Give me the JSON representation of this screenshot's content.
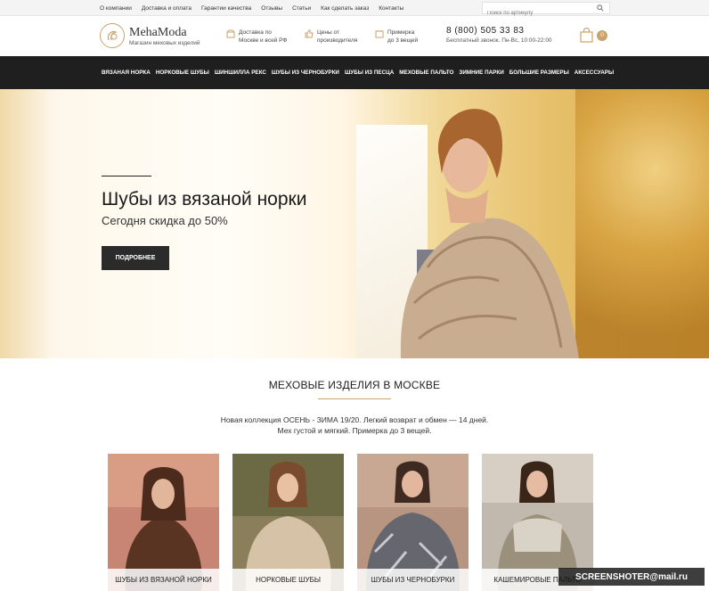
{
  "topbar": {
    "links": [
      "О компании",
      "Доставка и оплата",
      "Гарантии качества",
      "Отзывы",
      "Статьи",
      "Как сделать заказ",
      "Контакты"
    ],
    "search_placeholder": "Поиск по артикулу"
  },
  "header": {
    "logo_name": "MehaModa",
    "logo_sub": "Магазин меховых изделий",
    "features": [
      {
        "line1": "Доставка по",
        "line2": "Москве и всей РФ"
      },
      {
        "line1": "Цены от",
        "line2": "производителя"
      },
      {
        "line1": "Примерка",
        "line2": "до 3 вещей"
      }
    ],
    "phone": "8 (800) 505 33 83",
    "hours": "Бесплатный звонок. Пн-Вс, 10:00-22:00",
    "cart_count": "0"
  },
  "nav": {
    "items": [
      "ВЯЗАНАЯ НОРКА",
      "НОРКОВЫЕ ШУБЫ",
      "ШИНШИЛЛА РЕКС",
      "ШУБЫ ИЗ ЧЕРНОБУРКИ",
      "ШУБЫ ИЗ ПЕСЦА",
      "МЕХОВЫЕ ПАЛЬТО",
      "ЗИМНИЕ ПАРКИ",
      "БОЛЬШИЕ РАЗМЕРЫ",
      "АКСЕССУАРЫ"
    ]
  },
  "hero": {
    "title": "Шубы из вязаной норки",
    "subtitle": "Сегодня скидка до 50%",
    "button": "ПОДРОБНЕЕ"
  },
  "section": {
    "title": "МЕХОВЫЕ ИЗДЕЛИЯ В МОСКВЕ",
    "desc_line1": "Новая коллекция ОСЕНЬ - ЗИМА 19/20. Легкий возврат и обмен — 14 дней.",
    "desc_line2": "Мех густой и мягкий. Примерка до 3 вещей."
  },
  "products": [
    {
      "caption": "ШУБЫ ИЗ ВЯЗАНОЙ НОРКИ"
    },
    {
      "caption": "НОРКОВЫЕ ШУБЫ"
    },
    {
      "caption": "ШУБЫ ИЗ ЧЕРНОБУРКИ"
    },
    {
      "caption": "КАШЕМИРОВЫЕ ПАЛЬТО"
    }
  ],
  "watermark": "SCREENSHOTER@mail.ru",
  "colors": {
    "accent": "#c9a36b",
    "nav_bg": "#1f1f1f",
    "button_bg": "#2b2b2b"
  }
}
